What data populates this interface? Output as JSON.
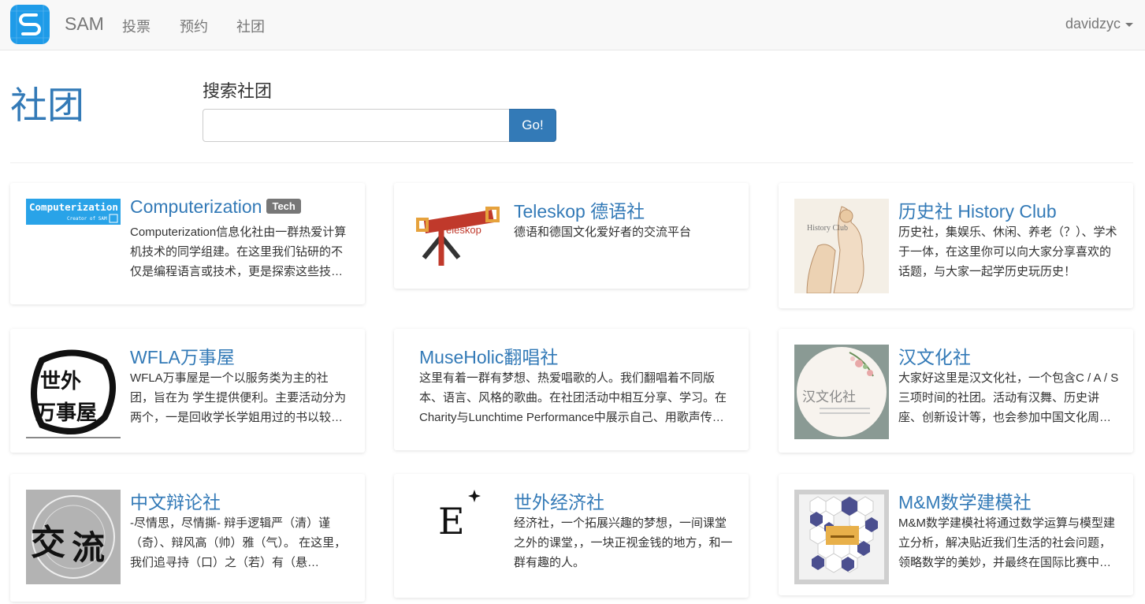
{
  "navbar": {
    "brand": "SAM",
    "links": [
      "投票",
      "预约",
      "社团"
    ],
    "user": "davidzyc"
  },
  "header": {
    "title": "社团",
    "search_label": "搜索社团",
    "search_value": "",
    "search_button": "Go!"
  },
  "clubs": [
    {
      "name": "Computerization",
      "tag": "Tech",
      "logo_text": "Computerization",
      "logo_subtext": "Creator of SAM",
      "description": "Computerization信息化社由一群热爱计算机技术的同学组建。在这里我们钻研的不仅是编程语言或技术，更是探索这些技…"
    },
    {
      "name": "Teleskop 德语社",
      "logo_text": "eleskop",
      "description": "德语和德国文化爱好者的交流平台"
    },
    {
      "name": "历史社 History Club",
      "logo_text": "History Club",
      "description": "历史社，集娱乐、休闲、养老（？）、学术于一体，在这里你可以向大家分享喜欢的话题，与大家一起学历史玩历史！"
    },
    {
      "name": "WFLA万事屋",
      "logo_text": "世外万事屋",
      "description": "WFLA万事屋是一个以服务类为主的社团，旨在为 学生提供便利。主要活动分为两个，一是回收学长学姐用过的书以较…"
    },
    {
      "name": "MuseHolic翻唱社",
      "description": "这里有着一群有梦想、热爱唱歌的人。我们翻唱着不同版本、语言、风格的歌曲。在社团活动中相互分享、学习。在Charity与Lunchtime Performance中展示自己、用歌声传…"
    },
    {
      "name": "汉文化社",
      "logo_text": "汉文化社",
      "description": "大家好这里是汉文化社，一个包含C / A / S三项时间的社团。活动有汉舞、历史讲座、创新设计等，也会参加中国文化周…"
    },
    {
      "name": "中文辩论社",
      "logo_text": "交流",
      "description": "-尽情思，尽情撕- 辩手逻辑严（清）谨（奇）、辩风高（帅）雅（气）。 在这里， 我们追寻持（口）之（若）有（悬…"
    },
    {
      "name": "世外经济社",
      "logo_text": "E",
      "description": "经济社，一个拓展兴趣的梦想，一间课堂之外的课堂，，一块正视金钱的地方，和一群有趣的人。"
    },
    {
      "name": "M&M数学建模社",
      "description": "M&M数学建模社将通过数学运算与模型建立分析，解决贴近我们生活的社会问题，领略数学的美妙，并最终在国际比赛中…"
    }
  ],
  "colors": {
    "accent": "#337ab7",
    "brand_logo": "#1e9be8",
    "tag": "#777777"
  }
}
